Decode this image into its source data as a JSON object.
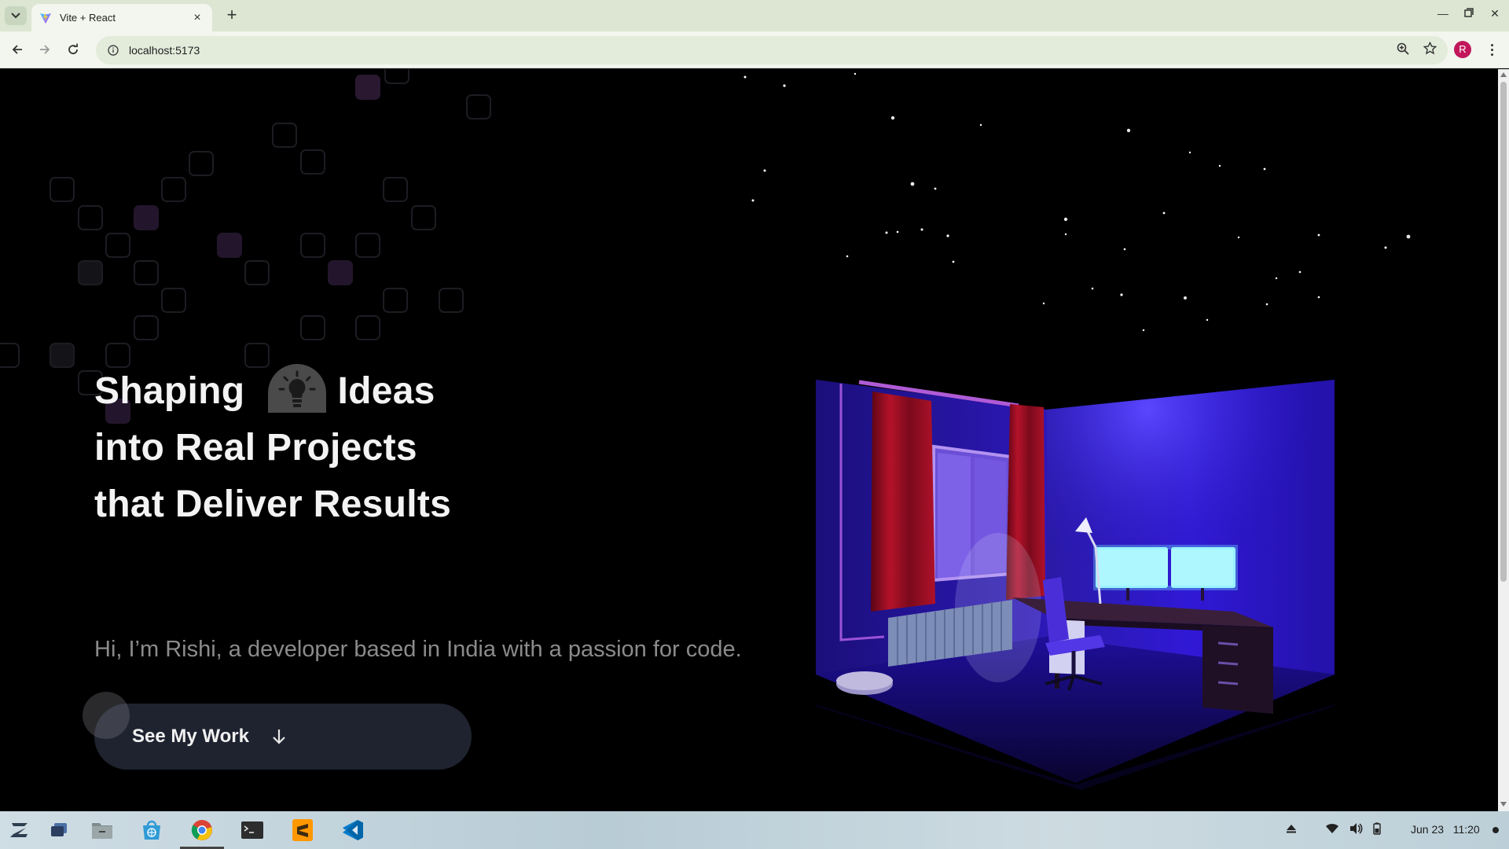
{
  "browser": {
    "tab_title": "Vite + React",
    "url": "localhost:5173",
    "profile_initial": "R"
  },
  "hero": {
    "line1_before": "Shaping",
    "line1_after": "Ideas",
    "line2": "into Real Projects",
    "line3": "that Deliver Results",
    "subtitle": "Hi, I’m Rishi, a developer based in India with a passion for code.",
    "cta_label": "See My Work"
  },
  "taskbar": {
    "date": "Jun 23",
    "time": "11:20",
    "apps": [
      "zorin-menu-icon",
      "workspaces-icon",
      "files-icon",
      "software-store-icon",
      "chrome-icon",
      "terminal-icon",
      "sublime-text-icon",
      "vscode-icon"
    ]
  },
  "colors": {
    "page_bg": "#000000",
    "cta_bg": "#1f2330",
    "title": "#f3f3f3",
    "subtitle": "#8b8b8b",
    "room_glow": "#3a1cff",
    "monitor": "#aef7ff"
  }
}
